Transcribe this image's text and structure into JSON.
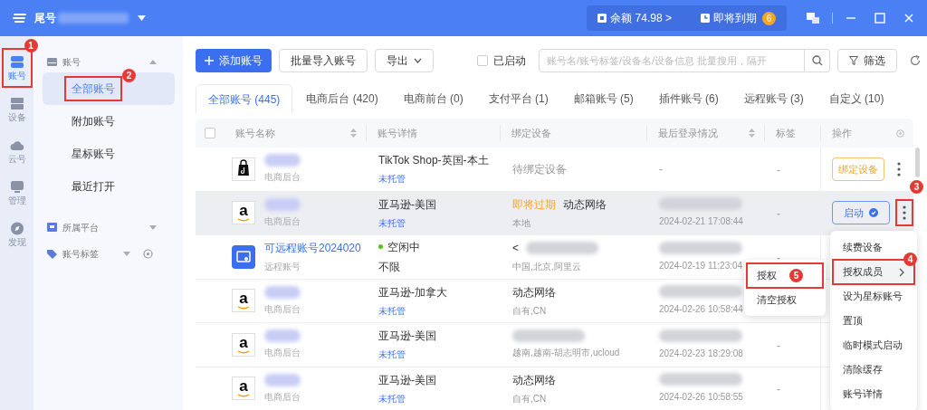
{
  "titlebar": {
    "account_label": "尾号",
    "balance": "余额 74.98",
    "balance_arrow": ">",
    "expiring": "即将到期",
    "expiring_count": "6"
  },
  "rail": [
    {
      "label": "账号",
      "selected": true,
      "kind": "account",
      "annotation": "1"
    },
    {
      "label": "设备",
      "selected": false,
      "kind": "device"
    },
    {
      "label": "云号",
      "selected": false,
      "kind": "cloud"
    },
    {
      "label": "管理",
      "selected": false,
      "kind": "manage"
    },
    {
      "label": "发现",
      "selected": false,
      "kind": "discover"
    }
  ],
  "sidebar": {
    "groups": [
      {
        "label": "账号",
        "kind": "account",
        "expanded": true,
        "settings": false,
        "items": [
          {
            "label": "全部账号",
            "selected": true,
            "annotation": "2"
          },
          {
            "label": "附加账号",
            "selected": false
          },
          {
            "label": "星标账号",
            "selected": false
          },
          {
            "label": "最近打开",
            "selected": false
          }
        ]
      },
      {
        "label": "所属平台",
        "kind": "platform",
        "expanded": false,
        "settings": false
      },
      {
        "label": "账号标签",
        "kind": "tag",
        "expanded": false,
        "settings": true
      }
    ]
  },
  "toolbar": {
    "add": "添加账号",
    "import": "批量导入账号",
    "export": "导出",
    "started": {
      "label": "已启动",
      "checked": false
    },
    "search_placeholder": "账号名/账号标签/设备名/设备信息 批量搜用，隔开",
    "filter": "筛选"
  },
  "tabs": [
    {
      "label": "全部账号 (445)",
      "selected": true
    },
    {
      "label": "电商后台 (420)",
      "selected": false
    },
    {
      "label": "电商前台 (0)",
      "selected": false
    },
    {
      "label": "支付平台 (1)",
      "selected": false
    },
    {
      "label": "邮箱账号 (5)",
      "selected": false
    },
    {
      "label": "插件账号 (6)",
      "selected": false
    },
    {
      "label": "远程账号 (3)",
      "selected": false
    },
    {
      "label": "自定义 (10)",
      "selected": false
    }
  ],
  "table": {
    "select_all_checked": false,
    "columns": [
      {
        "label": "账号名称",
        "sortable": true
      },
      {
        "label": "账号详情",
        "sortable": false
      },
      {
        "label": "绑定设备",
        "sortable": false
      },
      {
        "label": "最后登录情况",
        "sortable": true
      },
      {
        "label": "标签",
        "sortable": false
      },
      {
        "label": "操作",
        "sortable": false
      }
    ],
    "rows": [
      {
        "logo": {
          "kind": "tiktok"
        },
        "name_hidden": true,
        "subtitle": "电商后台",
        "detail": {
          "kind": "platform",
          "title": "TikTok Shop-英国-本土",
          "sub": "未托管"
        },
        "device": {
          "kind": "pending",
          "title": "待绑定设备"
        },
        "login": {
          "kind": "none",
          "text": "-"
        },
        "tag": "-",
        "highlighted": false,
        "action": {
          "kind": "bind",
          "label": "绑定设备"
        }
      },
      {
        "logo": {
          "kind": "amazon",
          "text": "a"
        },
        "name_hidden": true,
        "subtitle": "电商后台",
        "detail": {
          "kind": "platform",
          "title": "亚马逊-美国",
          "sub": "未托管"
        },
        "device": {
          "kind": "network",
          "warning": "即将过期",
          "title": "动态网络",
          "sub": "本地"
        },
        "login": {
          "kind": "time",
          "text": "2024-02-21 17:08:44"
        },
        "tag": "-",
        "highlighted": true,
        "action": {
          "kind": "launch",
          "label": "启动",
          "annotation": "3"
        }
      },
      {
        "logo": {
          "kind": "remote"
        },
        "name_hidden": false,
        "name": "可远程账号2024020",
        "subtitle": "远程账号",
        "detail": {
          "kind": "status",
          "title": "空闲中",
          "color": "#52c41a",
          "sub": "不限"
        },
        "device": {
          "kind": "hidden",
          "title": "<",
          "sub": "中国,北京,阿里云"
        },
        "login": {
          "kind": "time",
          "text": "2024-02-19 11:23:04"
        },
        "tag": "-",
        "highlighted": false
      },
      {
        "logo": {
          "kind": "amazon",
          "text": "a"
        },
        "name_hidden": true,
        "subtitle": "电商后台",
        "detail": {
          "kind": "platform",
          "title": "亚马逊-加拿大",
          "sub": "未托管"
        },
        "device": {
          "kind": "network",
          "title": "动态网络",
          "sub": "自有,CN"
        },
        "login": {
          "kind": "time",
          "text": "2024-02-26 10:58:44"
        },
        "highlighted": false
      },
      {
        "logo": {
          "kind": "amazon",
          "text": "a"
        },
        "name_hidden": true,
        "subtitle": "电商后台",
        "detail": {
          "kind": "platform",
          "title": "亚马逊-美国",
          "sub": "未托管"
        },
        "device": {
          "kind": "hidden",
          "sub": "越南,越南-胡志明市,ucloud"
        },
        "login": {
          "kind": "time",
          "text": "2024-02-23 18:29:08"
        },
        "tag": "-",
        "highlighted": false
      },
      {
        "logo": {
          "kind": "amazon",
          "text": "a"
        },
        "name_hidden": true,
        "subtitle": "电商后台",
        "detail": {
          "kind": "platform",
          "title": "亚马逊-美国",
          "sub": "未托管"
        },
        "device": {
          "kind": "network",
          "title": "动态网络",
          "sub": "自有,CN"
        },
        "login": {
          "kind": "time",
          "text": "2024-02-26 10:58:55"
        },
        "tag": "-",
        "highlighted": false
      }
    ]
  },
  "menu": {
    "items": [
      {
        "label": "续费设备",
        "selected": false
      },
      {
        "label": "授权成员",
        "selected": true,
        "submenu": true,
        "annotation": "4"
      },
      {
        "label": "设为星标账号",
        "selected": false
      },
      {
        "label": "置顶",
        "selected": false
      },
      {
        "label": "临时模式启动",
        "selected": false
      },
      {
        "label": "清除缓存",
        "selected": false
      },
      {
        "label": "账号详情",
        "selected": false
      }
    ],
    "submenu": {
      "items": [
        {
          "label": "授权",
          "selected": false,
          "annotation": "5"
        },
        {
          "label": "清空授权",
          "selected": false
        }
      ]
    }
  }
}
